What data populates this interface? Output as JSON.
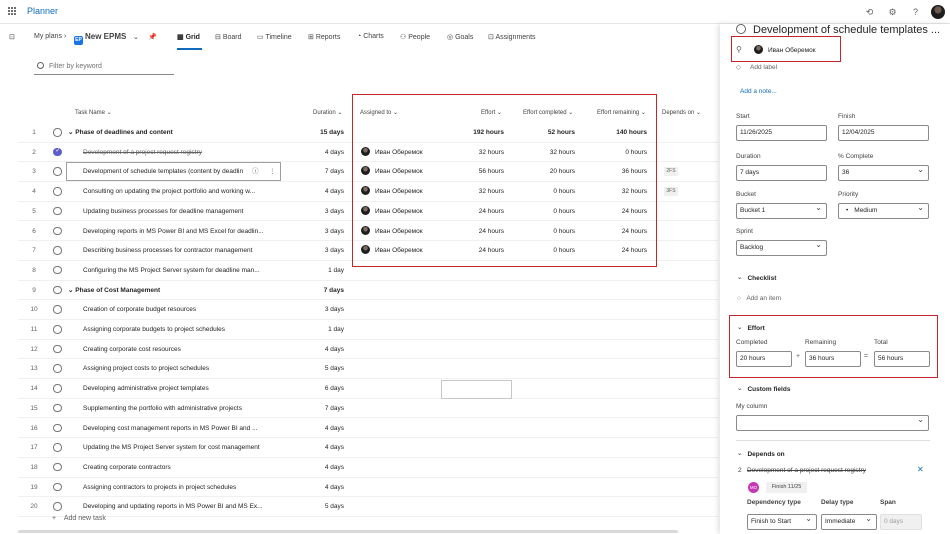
{
  "app": {
    "title": "Planner"
  },
  "nav": {
    "breadcrumb": "My plans",
    "plan_name": "New EPMS",
    "plan_badge": "EP",
    "tabs": [
      "Grid",
      "Board",
      "Timeline",
      "Reports",
      "Charts",
      "People",
      "Goals",
      "Assignments"
    ],
    "active_tab": "Grid"
  },
  "filter": {
    "placeholder": "Filter by keyword"
  },
  "columns": {
    "task_name": "Task Name",
    "duration": "Duration",
    "assigned_to": "Assigned to",
    "effort": "Effort",
    "effort_completed": "Effort completed",
    "effort_remaining": "Effort remaining",
    "depends_on": "Depends on"
  },
  "rows": [
    {
      "num": "1",
      "name": "Phase of deadlines and content",
      "phase": true,
      "duration": "15 days",
      "assignee": "",
      "effort": "192 hours",
      "completed": "52 hours",
      "remaining": "140 hours",
      "dep": ""
    },
    {
      "num": "2",
      "name": "Development of a project request registry",
      "done": true,
      "duration": "4 days",
      "assignee": "Иван Оберемок",
      "effort": "32 hours",
      "completed": "32 hours",
      "remaining": "0 hours",
      "dep": ""
    },
    {
      "num": "3",
      "name": "Development of schedule templates (content by deadlin",
      "duration": "7 days",
      "assignee": "Иван Оберемок",
      "effort": "56 hours",
      "completed": "20 hours",
      "remaining": "36 hours",
      "dep": "2FS"
    },
    {
      "num": "4",
      "name": "Consulting on updating the project portfolio and working w...",
      "duration": "4 days",
      "assignee": "Иван Оберемок",
      "effort": "32 hours",
      "completed": "0 hours",
      "remaining": "32 hours",
      "dep": "3FS"
    },
    {
      "num": "5",
      "name": "Updating business processes for deadline management",
      "duration": "3 days",
      "assignee": "Иван Оберемок",
      "effort": "24 hours",
      "completed": "0 hours",
      "remaining": "24 hours",
      "dep": ""
    },
    {
      "num": "6",
      "name": "Developing reports in MS Power BI and MS Excel for deadlin...",
      "duration": "3 days",
      "assignee": "Иван Оберемок",
      "effort": "24 hours",
      "completed": "0 hours",
      "remaining": "24 hours",
      "dep": ""
    },
    {
      "num": "7",
      "name": "Describing business processes for contractor management",
      "duration": "3 days",
      "assignee": "Иван Оберемок",
      "effort": "24 hours",
      "completed": "0 hours",
      "remaining": "24 hours",
      "dep": ""
    },
    {
      "num": "8",
      "name": "Configuring the MS Project Server system for deadline man...",
      "duration": "1 day",
      "assignee": "",
      "effort": "",
      "completed": "",
      "remaining": "",
      "dep": ""
    },
    {
      "num": "9",
      "name": "Phase of Cost Management",
      "phase": true,
      "duration": "7 days",
      "assignee": "",
      "effort": "",
      "completed": "",
      "remaining": "",
      "dep": ""
    },
    {
      "num": "10",
      "name": "Creation of corporate budget resources",
      "duration": "3 days",
      "assignee": "",
      "effort": "",
      "completed": "",
      "remaining": "",
      "dep": ""
    },
    {
      "num": "11",
      "name": "Assigning corporate budgets to project schedules",
      "duration": "1 day",
      "assignee": "",
      "effort": "",
      "completed": "",
      "remaining": "",
      "dep": ""
    },
    {
      "num": "12",
      "name": "Creating corporate cost resources",
      "duration": "4 days",
      "assignee": "",
      "effort": "",
      "completed": "",
      "remaining": "",
      "dep": ""
    },
    {
      "num": "13",
      "name": "Assigning project costs to project schedules",
      "duration": "5 days",
      "assignee": "",
      "effort": "",
      "completed": "",
      "remaining": "",
      "dep": ""
    },
    {
      "num": "14",
      "name": "Developing administrative project templates",
      "duration": "6 days",
      "assignee": "",
      "effort": "",
      "completed": "",
      "remaining": "",
      "dep": ""
    },
    {
      "num": "15",
      "name": "Supplementing the portfolio with administrative projects",
      "duration": "7 days",
      "assignee": "",
      "effort": "",
      "completed": "",
      "remaining": "",
      "dep": ""
    },
    {
      "num": "16",
      "name": "Developing cost management reports in MS Power BI and ...",
      "duration": "4 days",
      "assignee": "",
      "effort": "",
      "completed": "",
      "remaining": "",
      "dep": ""
    },
    {
      "num": "17",
      "name": "Updating the MS Project Server system for cost management",
      "duration": "4 days",
      "assignee": "",
      "effort": "",
      "completed": "",
      "remaining": "",
      "dep": ""
    },
    {
      "num": "18",
      "name": "Creating corporate contractors",
      "duration": "4 days",
      "assignee": "",
      "effort": "",
      "completed": "",
      "remaining": "",
      "dep": ""
    },
    {
      "num": "19",
      "name": "Assigning contractors to projects in project schedules",
      "duration": "4 days",
      "assignee": "",
      "effort": "",
      "completed": "",
      "remaining": "",
      "dep": ""
    },
    {
      "num": "20",
      "name": "Developing and updating reports in MS Power BI and MS Ex...",
      "duration": "5 days",
      "assignee": "",
      "effort": "",
      "completed": "",
      "remaining": "",
      "dep": ""
    }
  ],
  "add_task": "Add new task",
  "panel": {
    "title": "Development of schedule templates ...",
    "assignee": "Иван Оберемок",
    "add_label": "Add label",
    "add_note": "Add a note...",
    "start_label": "Start",
    "start_value": "11/26/2025",
    "finish_label": "Finish",
    "finish_value": "12/04/2025",
    "duration_label": "Duration",
    "duration_value": "7 days",
    "complete_label": "% Complete",
    "complete_value": "36",
    "bucket_label": "Bucket",
    "bucket_value": "Bucket 1",
    "priority_label": "Priority",
    "priority_value": "Medium",
    "sprint_label": "Sprint",
    "sprint_value": "Backlog",
    "checklist_label": "Checklist",
    "add_item": "Add an item",
    "effort_label": "Effort",
    "completed_label": "Completed",
    "completed_value": "20 hours",
    "remaining_label": "Remaining",
    "remaining_value": "36 hours",
    "total_label": "Total",
    "total_value": "56 hours",
    "custom_fields_label": "Custom fields",
    "my_column_label": "My column",
    "depends_on_label": "Depends on",
    "dep_num": "2",
    "dep_task": "Development of a project request registry",
    "dep_badge": "MO",
    "dep_finish": "Finish 11/25",
    "dep_type_label": "Dependency type",
    "dep_type_value": "Finish to Start",
    "delay_type_label": "Delay type",
    "delay_type_value": "Immediate",
    "span_label": "Span",
    "span_value": "0 days"
  },
  "colors": {
    "accent": "#0f6cbd",
    "highlight": "#c4262e",
    "done": "#5b5fc7"
  }
}
